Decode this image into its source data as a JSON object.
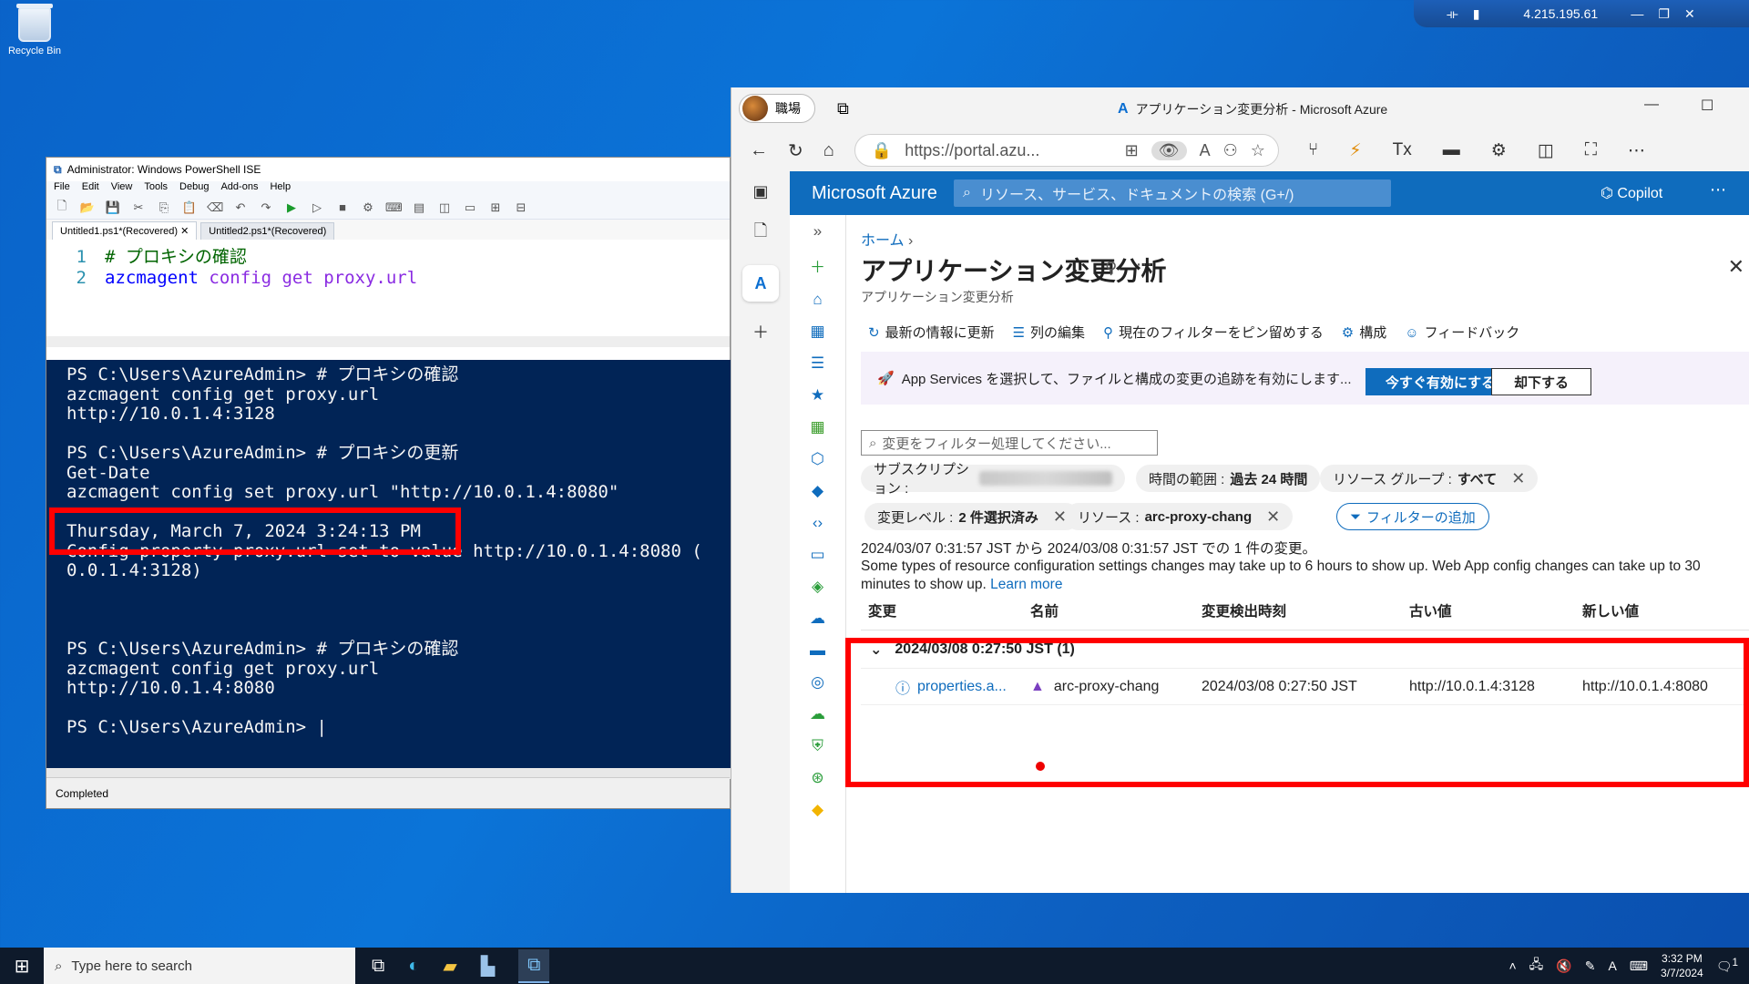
{
  "desktop": {
    "recycle_bin_label": "Recycle Bin",
    "rdp_ip": "4.215.195.61"
  },
  "ise": {
    "window_title": "Administrator: Windows PowerShell ISE",
    "menu": [
      "File",
      "Edit",
      "View",
      "Tools",
      "Debug",
      "Add-ons",
      "Help"
    ],
    "tabs": [
      "Untitled1.ps1*(Recovered)",
      "Untitled2.ps1*(Recovered)"
    ],
    "editor": {
      "line1_no": "1",
      "line1": "# プロキシの確認",
      "line2_no": "2",
      "line2_cmd": "azcmagent",
      "line2_args": "config get proxy.url"
    },
    "console_lines": [
      "PS C:\\Users\\AzureAdmin> # プロキシの確認",
      "azcmagent config get proxy.url",
      "http://10.0.1.4:3128",
      "",
      "PS C:\\Users\\AzureAdmin> # プロキシの更新",
      "Get-Date",
      "azcmagent config set proxy.url \"http://10.0.1.4:8080\"",
      "",
      "Thursday, March 7, 2024 3:24:13 PM",
      "Config property proxy.url set to value http://10.0.1.4:8080 (",
      "0.0.1.4:3128)",
      "",
      "",
      "",
      "PS C:\\Users\\AzureAdmin> # プロキシの確認",
      "azcmagent config get proxy.url",
      "http://10.0.1.4:8080",
      "",
      "PS C:\\Users\\AzureAdmin> |"
    ],
    "status": "Completed"
  },
  "edge": {
    "profile_label": "職場",
    "window_title": "アプリケーション変更分析 - Microsoft Azure",
    "url": "https://portal.azu...",
    "brand": "Microsoft Azure",
    "search_placeholder": "リソース、サービス、ドキュメントの検索 (G+/)",
    "copilot": "Copilot"
  },
  "page": {
    "breadcrumb": "ホーム",
    "title": "アプリケーション変更分析",
    "subtitle": "アプリケーション変更分析",
    "commands": [
      "最新の情報に更新",
      "列の編集",
      "現在のフィルターをピン留めする",
      "構成",
      "フィードバック"
    ],
    "banner_text": "App Services を選択して、ファイルと構成の変更の追跡を有効にします...",
    "banner_primary": "今すぐ有効にする",
    "banner_secondary": "却下する",
    "filter_placeholder": "変更をフィルター処理してください...",
    "pills": {
      "subscription_label": "サブスクリプション :",
      "time_label": "時間の範囲 :",
      "time_value": "過去 24 時間",
      "rg_label": "リソース グループ :",
      "rg_value": "すべて",
      "level_label": "変更レベル :",
      "level_value": "2 件選択済み",
      "resource_label": "リソース :",
      "resource_value": "arc-proxy-chang",
      "add_filter": "フィルターの追加"
    },
    "summary": "2024/03/07 0:31:57 JST から 2024/03/08 0:31:57 JST での 1 件の変更。",
    "note": "Some types of resource configuration settings changes may take up to 6 hours to show up. Web App config changes can take up to 30 minutes to show up.",
    "learn_more": "Learn more",
    "table": {
      "headers": [
        "変更",
        "名前",
        "変更検出時刻",
        "古い値",
        "新しい値"
      ],
      "group": "2024/03/08 0:27:50 JST (1)",
      "row": {
        "change": "properties.a...",
        "name": "arc-proxy-chang",
        "time": "2024/03/08 0:27:50 JST",
        "old": "http://10.0.1.4:3128",
        "new": "http://10.0.1.4:8080"
      }
    }
  },
  "taskbar": {
    "search_placeholder": "Type here to search",
    "time": "3:32 PM",
    "date": "3/7/2024",
    "notification_count": "1"
  },
  "colors": {
    "azure_blue": "#0f6cbd",
    "console_bg": "#012456",
    "highlight_red": "#ff0000"
  }
}
